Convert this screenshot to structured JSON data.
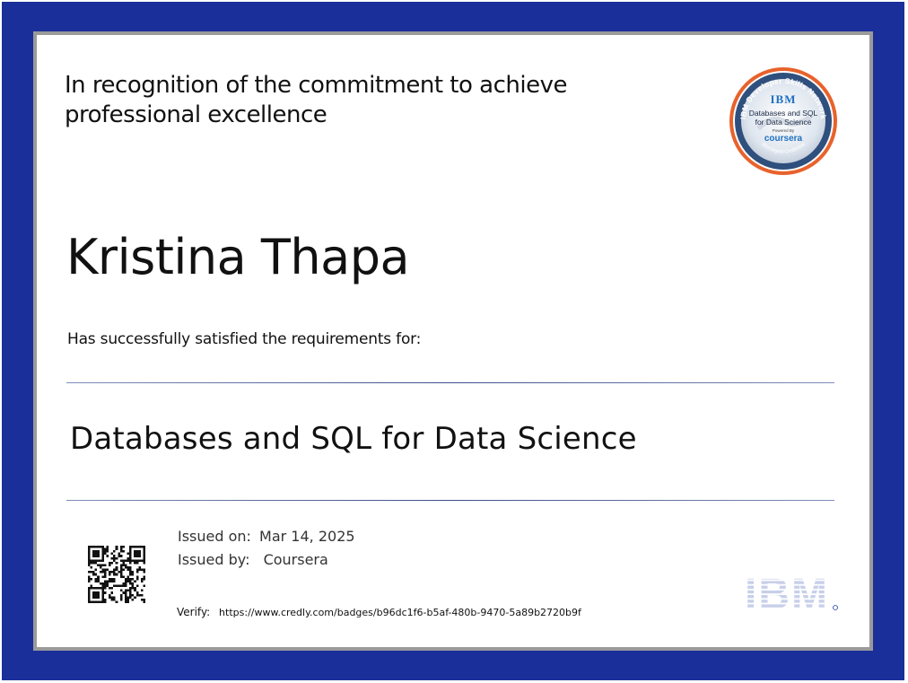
{
  "header": {
    "recognition_line1": "In recognition of the commitment to achieve",
    "recognition_line2": "professional excellence"
  },
  "badge": {
    "ring_text": "IBM Developer Skills Network",
    "brand": "IBM",
    "course_line1": "Databases and SQL",
    "course_line2": "for Data Science",
    "powered_by": "Powered By",
    "partner": "coursera",
    "footer_text": "IBM Digital Credential",
    "colors": {
      "ring": "#e8622c",
      "brand": "#1f70c1"
    }
  },
  "recipient": {
    "name": "Kristina Thapa"
  },
  "requirement_text": "Has successfully satisfied the requirements for:",
  "course": {
    "title": "Databases and SQL for Data Science"
  },
  "issue": {
    "date_label": "Issued on:",
    "date_value": "Mar 14, 2025",
    "issuer_label": "Issued by:",
    "issuer_value": "Coursera"
  },
  "verify": {
    "label": "Verify:",
    "url": "https://www.credly.com/badges/b96dc1f6-b5af-480b-9470-5a89b2720b9f"
  },
  "logo": {
    "brand": "IBM",
    "color": "#1f3fa8"
  },
  "colors": {
    "frame": "#1b2f9a"
  }
}
